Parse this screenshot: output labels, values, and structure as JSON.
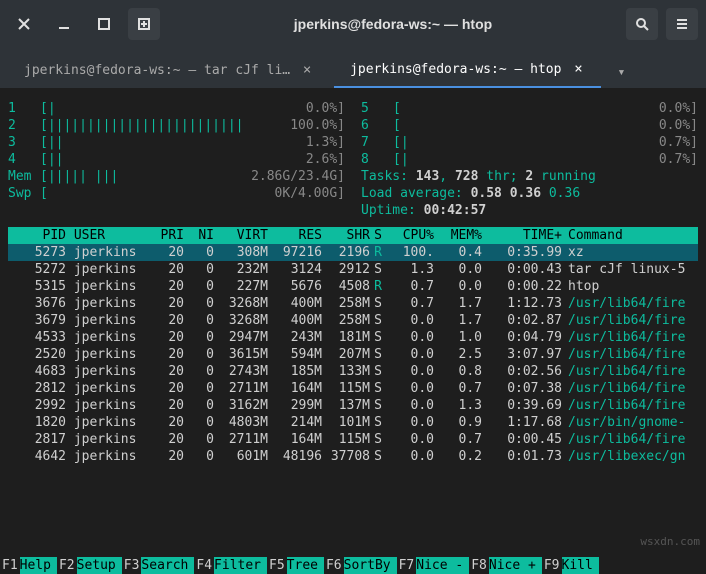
{
  "window": {
    "title": "jperkins@fedora-ws:~ — htop"
  },
  "tabs": {
    "inactive": "jperkins@fedora-ws:~ — tar cJf li…",
    "active": "jperkins@fedora-ws:~ — htop"
  },
  "meters": {
    "left": [
      {
        "n": "1",
        "bar": "[|                          ",
        "val": "0.0%]"
      },
      {
        "n": "2",
        "bar": "[|||||||||||||||||||||||||",
        "val": "100.0%]"
      },
      {
        "n": "3",
        "bar": "[||                         ",
        "val": "1.3%]"
      },
      {
        "n": "4",
        "bar": "[||                         ",
        "val": "2.6%]"
      },
      {
        "n": "Mem",
        "bar": "[||||| |||                ",
        "val": "2.86G/23.4G]"
      },
      {
        "n": "Swp",
        "bar": "[                         ",
        "val": "0K/4.00G]"
      }
    ],
    "right": [
      {
        "n": "5",
        "bar": "[                           ",
        "val": "0.0%]"
      },
      {
        "n": "6",
        "bar": "[                           ",
        "val": "0.0%]"
      },
      {
        "n": "7",
        "bar": "[|                          ",
        "val": "0.7%]"
      },
      {
        "n": "8",
        "bar": "[|                          ",
        "val": "0.7%]"
      }
    ],
    "tasks_l": "Tasks: ",
    "tasks_n": "143",
    "tasks_c": ", ",
    "tasks_t": "728",
    "tasks_s": " thr; ",
    "tasks_r": "2",
    "tasks_e": " running",
    "load_l": "Load average: ",
    "load_1": "0.58",
    "load_2": " 0.36",
    "load_3": " 0.36",
    "uptime_l": "Uptime: ",
    "uptime_v": "00:42:57"
  },
  "hdr": {
    "pid": "PID",
    "user": "USER",
    "pri": "PRI",
    "ni": "NI",
    "virt": "VIRT",
    "res": "RES",
    "shr": "SHR",
    "s": "S",
    "cpu": "CPU%",
    "mem": "MEM%",
    "time": "TIME+",
    "cmd": "Command"
  },
  "proc": [
    {
      "pid": "5273",
      "user": "jperkins",
      "pri": "20",
      "ni": "0",
      "virt": "308M",
      "res": "97216",
      "shr": "2196",
      "s": "R",
      "cpu": "100.",
      "mem": "0.4",
      "time": "0:35.99",
      "cmd": "xz",
      "sel": true
    },
    {
      "pid": "5272",
      "user": "jperkins",
      "pri": "20",
      "ni": "0",
      "virt": "232M",
      "res": "3124",
      "shr": "2912",
      "s": "S",
      "cpu": "1.3",
      "mem": "0.0",
      "time": "0:00.43",
      "cmd": "tar cJf linux-5"
    },
    {
      "pid": "5315",
      "user": "jperkins",
      "pri": "20",
      "ni": "0",
      "virt": "227M",
      "res": "5676",
      "shr": "4508",
      "s": "R",
      "cpu": "0.7",
      "mem": "0.0",
      "time": "0:00.22",
      "cmd": "htop"
    },
    {
      "pid": "3676",
      "user": "jperkins",
      "pri": "20",
      "ni": "0",
      "virt": "3268M",
      "res": "400M",
      "shr": "258M",
      "s": "S",
      "cpu": "0.7",
      "mem": "1.7",
      "time": "1:12.73",
      "cmd": "/usr/lib64/fire",
      "p": true
    },
    {
      "pid": "3679",
      "user": "jperkins",
      "pri": "20",
      "ni": "0",
      "virt": "3268M",
      "res": "400M",
      "shr": "258M",
      "s": "S",
      "cpu": "0.0",
      "mem": "1.7",
      "time": "0:02.87",
      "cmd": "/usr/lib64/fire",
      "p": true
    },
    {
      "pid": "4533",
      "user": "jperkins",
      "pri": "20",
      "ni": "0",
      "virt": "2947M",
      "res": "243M",
      "shr": "181M",
      "s": "S",
      "cpu": "0.0",
      "mem": "1.0",
      "time": "0:04.79",
      "cmd": "/usr/lib64/fire",
      "p": true
    },
    {
      "pid": "2520",
      "user": "jperkins",
      "pri": "20",
      "ni": "0",
      "virt": "3615M",
      "res": "594M",
      "shr": "207M",
      "s": "S",
      "cpu": "0.0",
      "mem": "2.5",
      "time": "3:07.97",
      "cmd": "/usr/lib64/fire",
      "p": true
    },
    {
      "pid": "4683",
      "user": "jperkins",
      "pri": "20",
      "ni": "0",
      "virt": "2743M",
      "res": "185M",
      "shr": "133M",
      "s": "S",
      "cpu": "0.0",
      "mem": "0.8",
      "time": "0:02.56",
      "cmd": "/usr/lib64/fire",
      "p": true
    },
    {
      "pid": "2812",
      "user": "jperkins",
      "pri": "20",
      "ni": "0",
      "virt": "2711M",
      "res": "164M",
      "shr": "115M",
      "s": "S",
      "cpu": "0.0",
      "mem": "0.7",
      "time": "0:07.38",
      "cmd": "/usr/lib64/fire",
      "p": true
    },
    {
      "pid": "2992",
      "user": "jperkins",
      "pri": "20",
      "ni": "0",
      "virt": "3162M",
      "res": "299M",
      "shr": "137M",
      "s": "S",
      "cpu": "0.0",
      "mem": "1.3",
      "time": "0:39.69",
      "cmd": "/usr/lib64/fire",
      "p": true
    },
    {
      "pid": "1820",
      "user": "jperkins",
      "pri": "20",
      "ni": "0",
      "virt": "4803M",
      "res": "214M",
      "shr": "101M",
      "s": "S",
      "cpu": "0.0",
      "mem": "0.9",
      "time": "1:17.68",
      "cmd": "/usr/bin/gnome-",
      "p": true
    },
    {
      "pid": "2817",
      "user": "jperkins",
      "pri": "20",
      "ni": "0",
      "virt": "2711M",
      "res": "164M",
      "shr": "115M",
      "s": "S",
      "cpu": "0.0",
      "mem": "0.7",
      "time": "0:00.45",
      "cmd": "/usr/lib64/fire",
      "p": true
    },
    {
      "pid": "4642",
      "user": "jperkins",
      "pri": "20",
      "ni": "0",
      "virt": "601M",
      "res": "48196",
      "shr": "37708",
      "s": "S",
      "cpu": "0.0",
      "mem": "0.2",
      "time": "0:01.73",
      "cmd": "/usr/libexec/gn",
      "p": true
    }
  ],
  "fkeys": [
    {
      "k": "F1",
      "l": "Help"
    },
    {
      "k": "F2",
      "l": "Setup"
    },
    {
      "k": "F3",
      "l": "Search"
    },
    {
      "k": "F4",
      "l": "Filter"
    },
    {
      "k": "F5",
      "l": "Tree"
    },
    {
      "k": "F6",
      "l": "SortBy"
    },
    {
      "k": "F7",
      "l": "Nice -"
    },
    {
      "k": "F8",
      "l": "Nice +"
    },
    {
      "k": "F9",
      "l": "Kill"
    }
  ],
  "watermark": "wsxdn.com"
}
